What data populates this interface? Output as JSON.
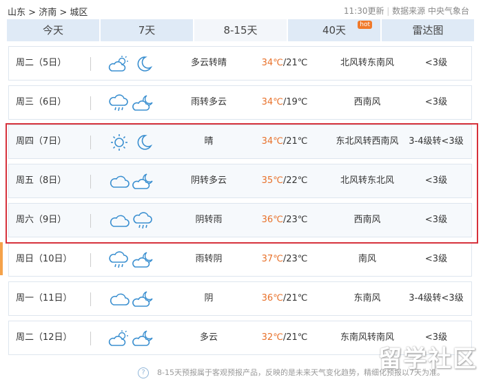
{
  "breadcrumb": {
    "province": "山东",
    "sep": ">",
    "city": "济南",
    "district": "城区"
  },
  "source": {
    "time": "11:30更新",
    "divider": "|",
    "label": "数据来源 中央气象台"
  },
  "tabs": [
    {
      "label": "今天"
    },
    {
      "label": "7天"
    },
    {
      "label": "8-15天",
      "active": true
    },
    {
      "label": "40天",
      "badge": "hot"
    },
    {
      "label": "雷达图"
    }
  ],
  "rows": [
    {
      "day": "周二（5日）",
      "icon1": "partly-cloudy-sun-icon",
      "icon2": "moon-icon",
      "desc": "多云转晴",
      "high": "34℃",
      "low": "/21℃",
      "wind": "北风转东南风",
      "level": "<3级"
    },
    {
      "day": "周三（6日）",
      "icon1": "rain-cloud-icon",
      "icon2": "cloud-moon-icon",
      "desc": "雨转多云",
      "high": "34℃",
      "low": "/19℃",
      "wind": "西南风",
      "level": "<3级"
    },
    {
      "day": "周四（7日）",
      "icon1": "sun-icon",
      "icon2": "moon-icon",
      "desc": "晴",
      "high": "34℃",
      "low": "/21℃",
      "wind": "东北风转西南风",
      "level": "3-4级转<3级"
    },
    {
      "day": "周五（8日）",
      "icon1": "cloud-icon",
      "icon2": "cloud-moon-icon",
      "desc": "阴转多云",
      "high": "35℃",
      "low": "/22℃",
      "wind": "北风转东北风",
      "level": "<3级"
    },
    {
      "day": "周六（9日）",
      "icon1": "cloud-icon",
      "icon2": "rain-cloud-icon",
      "desc": "阴转雨",
      "high": "36℃",
      "low": "/23℃",
      "wind": "西南风",
      "level": "<3级"
    },
    {
      "day": "周日（10日）",
      "icon1": "rain-cloud-icon",
      "icon2": "cloud-moon-icon",
      "desc": "雨转阴",
      "high": "37℃",
      "low": "/23℃",
      "wind": "南风",
      "level": "<3级"
    },
    {
      "day": "周一（11日）",
      "icon1": "cloud-icon",
      "icon2": "cloud-moon-icon",
      "desc": "阴",
      "high": "36℃",
      "low": "/21℃",
      "wind": "东南风",
      "level": "3-4级转<3级"
    },
    {
      "day": "周二（12日）",
      "icon1": "partly-cloudy-sun-icon",
      "icon2": "cloud-moon-icon",
      "desc": "多云",
      "high": "32℃",
      "low": "/21℃",
      "wind": "东南风转南风",
      "level": "<3级"
    }
  ],
  "footer": {
    "text": "8-15天预报属于客观预报产品，反映的是未来天气变化趋势，精细化预报以7天为准。"
  },
  "watermark": "留学社区",
  "colors": {
    "tab_bg": "#dfeaf6",
    "high_temp": "#e8712a",
    "highlight_box": "#d6303a",
    "icon_stroke": "#3a8fd0"
  }
}
